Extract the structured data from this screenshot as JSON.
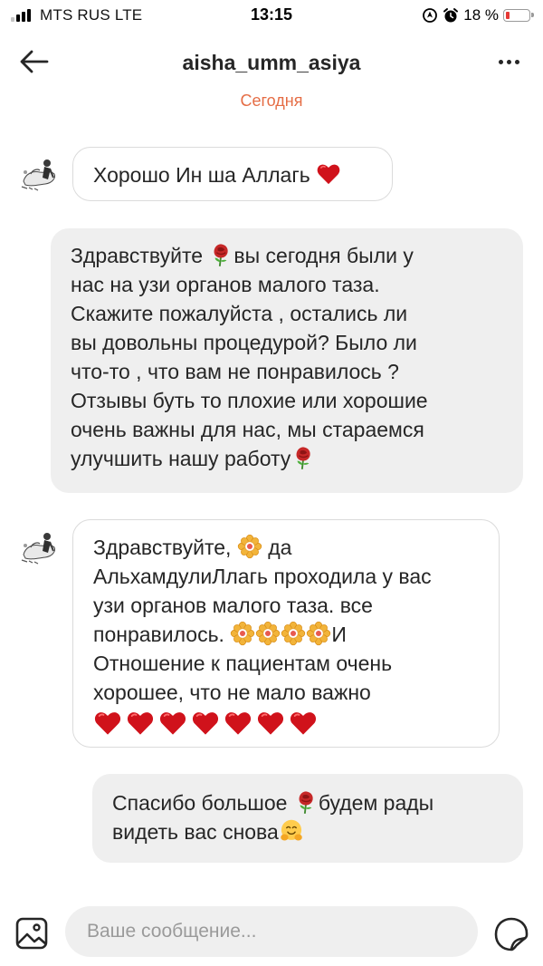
{
  "status_bar": {
    "carrier": "MTS RUS  LTE",
    "time": "13:15",
    "battery_percent": "18 %",
    "battery_level": 0.18,
    "icons": [
      "signal-icon",
      "location-icon",
      "alarm-icon",
      "battery-icon"
    ]
  },
  "header": {
    "username": "aisha_umm_asiya",
    "back_icon": "arrow-left-icon",
    "more_icon": "more-dots-icon"
  },
  "day_label": "Сегодня",
  "messages": [
    {
      "direction": "incoming",
      "lines": [
        "Хорошо Ин ша Аллагь",
        ""
      ],
      "emoji": [
        "heart-emoji"
      ]
    },
    {
      "direction": "outgoing",
      "lines": [
        "Здравствуйте",
        "вы сегодня были у",
        "нас на узи органов малого таза.",
        "Скажите пожалуйста , остались ли",
        "вы довольны процедурой? Было ли",
        "что-то , что вам не понравилось ?",
        "Отзывы буть то плохие или  хорошие",
        "очень важны для нас, мы стараемся",
        "улучшить нашу работу"
      ],
      "emoji": [
        "rose-emoji",
        "rose-emoji"
      ]
    },
    {
      "direction": "incoming",
      "lines": [
        "Здравствуйте,",
        "да",
        "АльхамдулиЛлагь проходила у вас",
        "узи органов малого таза.  все",
        "понравилось.",
        "И",
        "Отношение к пациентам очень",
        "хорошее, что не мало важно"
      ],
      "emoji": [
        "blossom-emoji",
        "heart-emoji"
      ]
    },
    {
      "direction": "outgoing",
      "lines": [
        "Спасибо большое",
        "будем рады",
        "видеть вас снова"
      ],
      "emoji": [
        "rose-emoji",
        "hugging-face-emoji"
      ]
    }
  ],
  "composer": {
    "placeholder": "Ваше сообщение...",
    "gallery_icon": "gallery-icon",
    "sticker_icon": "sticker-icon"
  },
  "colors": {
    "accent": "#e56d45",
    "heart": "#d0121b",
    "outgoing_bubble": "#efefef",
    "incoming_border": "#dbdbdb",
    "battery_low": "#e53935"
  }
}
